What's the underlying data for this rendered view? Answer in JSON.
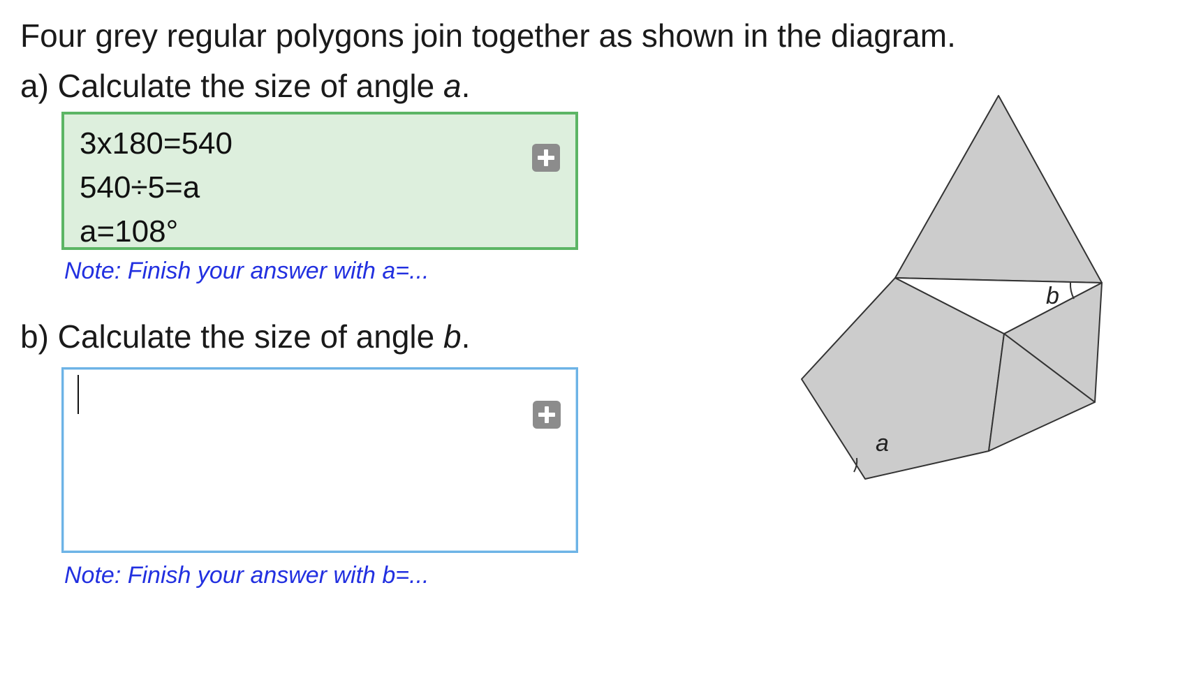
{
  "intro_text": "Four grey regular polygons join together as shown in the diagram.",
  "question_a": {
    "label": "a) Calculate the size of angle ",
    "angle_var": "a",
    "end": ".",
    "answer_lines": [
      "3x180=540",
      "540÷5=a",
      "a=108°"
    ],
    "note": "Note: Finish your answer with a=...",
    "add_button_icon": "plus-icon",
    "status_color": "#5cb565"
  },
  "question_b": {
    "label": "b) Calculate the size of angle ",
    "angle_var": "b",
    "end": ".",
    "answer_value": "",
    "note": "Note: Finish your answer with b=...",
    "add_button_icon": "plus-icon",
    "focus_color": "#6db3e6"
  },
  "diagram": {
    "shape_fill": "#cccccc",
    "labels": {
      "angle_a": "a",
      "angle_b": "b"
    }
  },
  "colors": {
    "note_text": "#2230e0",
    "correct_bg": "#ddefdd"
  }
}
